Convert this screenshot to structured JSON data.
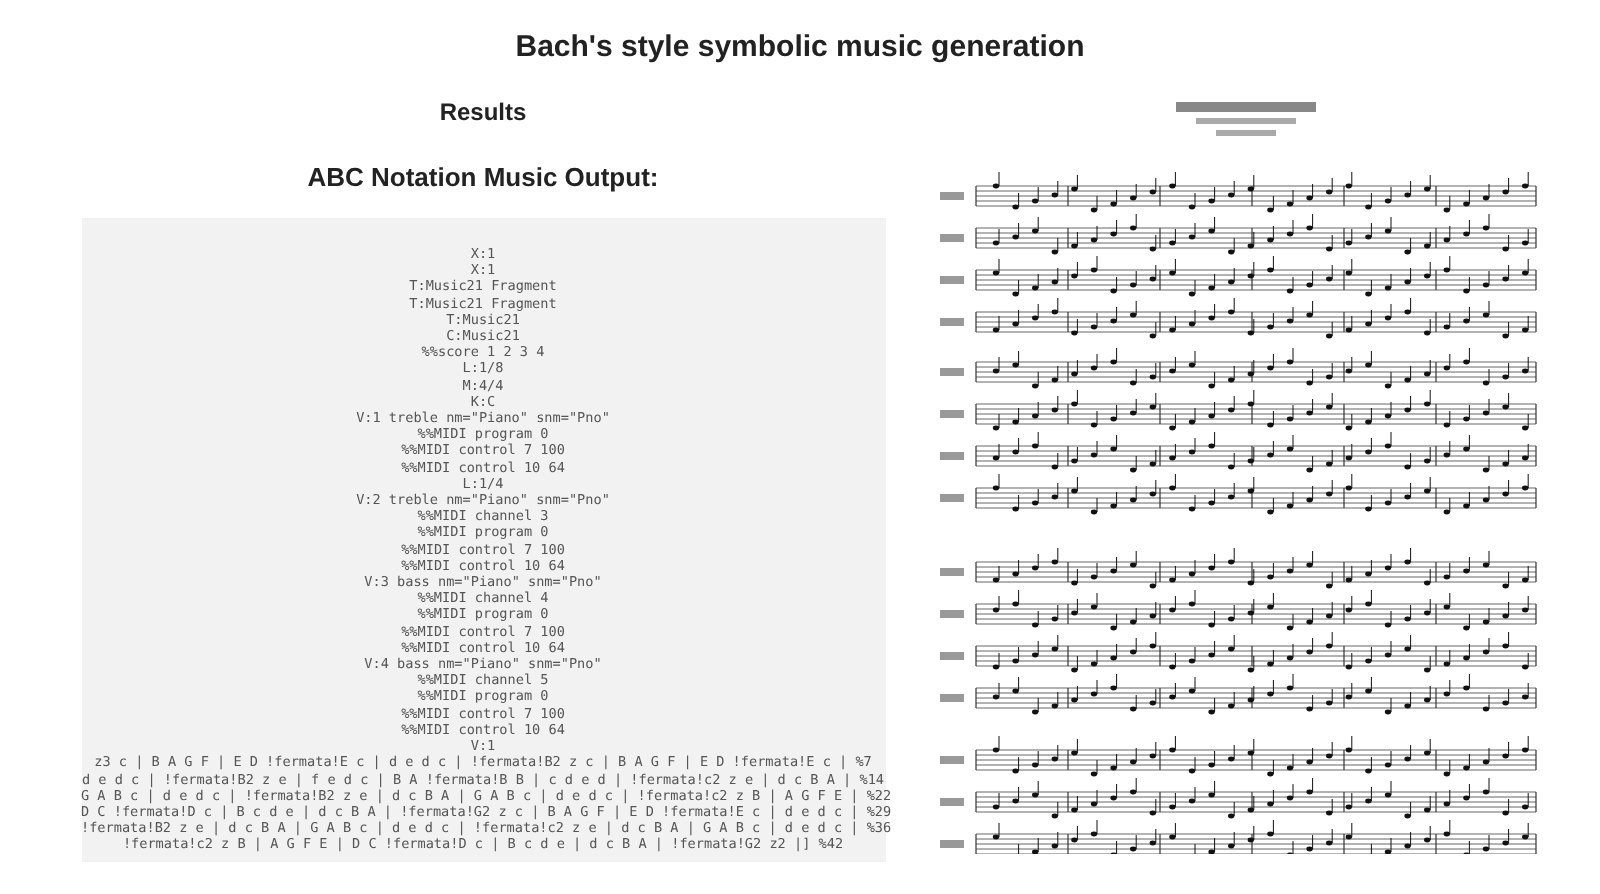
{
  "page": {
    "title": "Bach's style symbolic music generation"
  },
  "results": {
    "heading": "Results",
    "subheading": "ABC Notation Music Output:",
    "abc_lines": [
      "X:1",
      "X:1",
      "T:Music21 Fragment",
      "T:Music21 Fragment",
      "T:Music21",
      "C:Music21",
      "%%score 1 2 3 4",
      "L:1/8",
      "M:4/4",
      "K:C",
      "V:1 treble nm=\"Piano\" snm=\"Pno\"",
      "%%MIDI program 0",
      "%%MIDI control 7 100",
      "%%MIDI control 10 64",
      "L:1/4",
      "V:2 treble nm=\"Piano\" snm=\"Pno\"",
      "%%MIDI channel 3",
      "%%MIDI program 0",
      "%%MIDI control 7 100",
      "%%MIDI control 10 64",
      "V:3 bass nm=\"Piano\" snm=\"Pno\"",
      "%%MIDI channel 4",
      "%%MIDI program 0",
      "%%MIDI control 7 100",
      "%%MIDI control 10 64",
      "V:4 bass nm=\"Piano\" snm=\"Pno\"",
      "%%MIDI channel 5",
      "%%MIDI program 0",
      "%%MIDI control 7 100",
      "%%MIDI control 10 64",
      "V:1",
      "z3 c | B A G F | E D !fermata!E c | d e d c | !fermata!B2 z c | B A G F | E D !fermata!E c | %7",
      "d e d c | !fermata!B2 z e | f e d c | B A !fermata!B B | c d e d | !fermata!c2 z e | d c B A | %14",
      "G A B c | d e d c | !fermata!B2 z e | d c B A | G A B c | d e d c | !fermata!c2 z B | A G F E | %22",
      "D C !fermata!D c | B c d e | d c B A | !fermata!G2 z c | B A G F | E D !fermata!E c | d e d c | %29",
      "!fermata!B2 z e | d c B A | G A B c | d e d c | !fermata!c2 z e | d c B A | G A B c | d e d c | %36",
      "!fermata!c2 z B | A G F E | D C !fermata!D c | B c d e | d c B A | !fermata!G2 z2 |] %42"
    ]
  }
}
